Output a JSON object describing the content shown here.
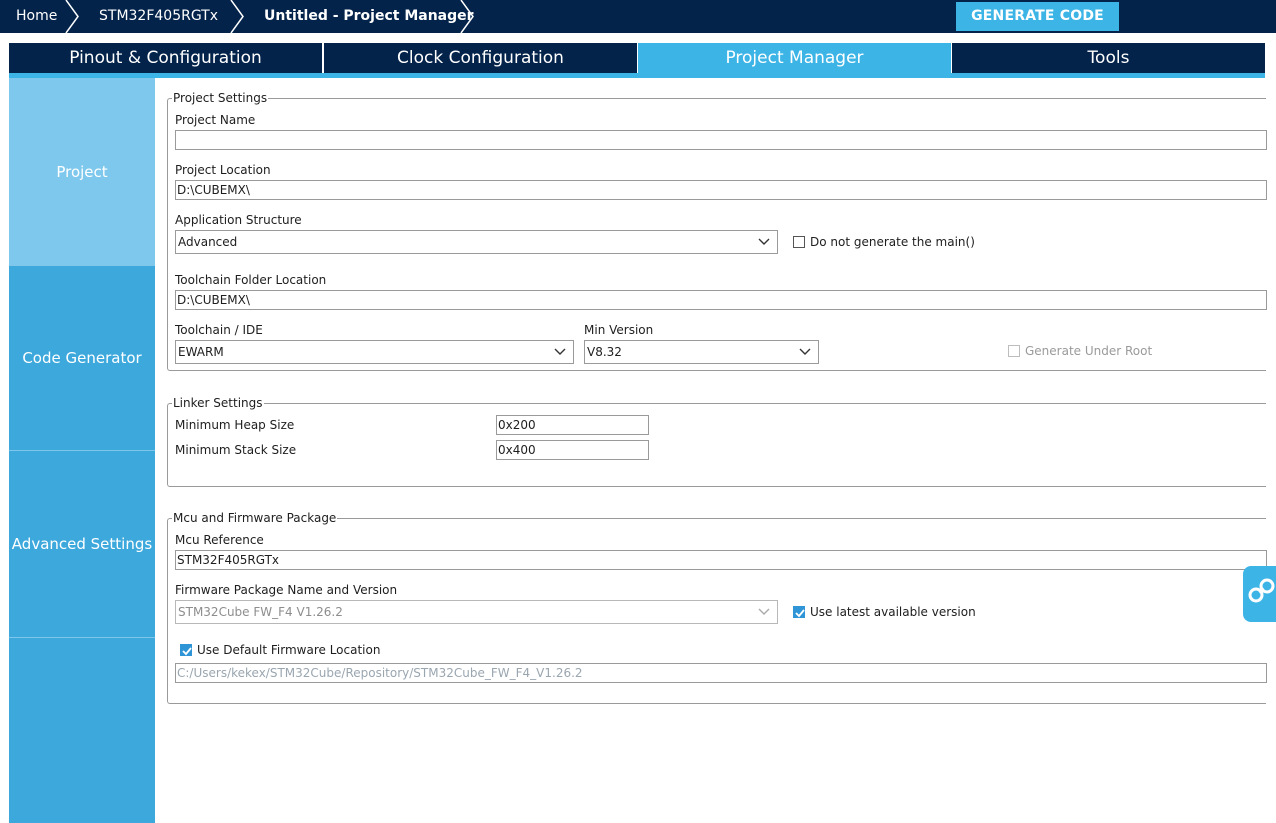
{
  "breadcrumb": {
    "home": "Home",
    "device": "STM32F405RGTx",
    "current": "Untitled - Project Manager"
  },
  "toolbar": {
    "generate_label": "GENERATE CODE"
  },
  "tabs": [
    {
      "label": "Pinout & Configuration"
    },
    {
      "label": "Clock Configuration"
    },
    {
      "label": "Project Manager"
    },
    {
      "label": "Tools"
    }
  ],
  "sidenav": {
    "items": [
      {
        "label": "Project"
      },
      {
        "label": "Code Generator"
      },
      {
        "label": "Advanced Settings"
      }
    ]
  },
  "project_settings": {
    "legend": "Project Settings",
    "project_name_label": "Project Name",
    "project_name_value": "",
    "project_location_label": "Project Location",
    "project_location_value": "D:\\CUBEMX\\",
    "app_structure_label": "Application Structure",
    "app_structure_value": "Advanced",
    "no_main_label": "Do not generate the main()",
    "toolchain_folder_label": "Toolchain Folder Location",
    "toolchain_folder_value": "D:\\CUBEMX\\",
    "toolchain_label": "Toolchain / IDE",
    "toolchain_value": "EWARM",
    "min_version_label": "Min Version",
    "min_version_value": "V8.32",
    "generate_root_label": "Generate Under Root"
  },
  "linker_settings": {
    "legend": "Linker Settings",
    "heap_label": "Minimum Heap Size",
    "heap_value": "0x200",
    "stack_label": "Minimum Stack Size",
    "stack_value": "0x400"
  },
  "mcu_firmware": {
    "legend": "Mcu and Firmware Package",
    "mcu_ref_label": "Mcu Reference",
    "mcu_ref_value": "STM32F405RGTx",
    "fw_label": "Firmware Package Name and Version",
    "fw_value": "STM32Cube FW_F4 V1.26.2",
    "latest_label": "Use latest available version",
    "default_loc_label": "Use Default Firmware Location",
    "fw_path_value": "C:/Users/kekex/STM32Cube/Repository/STM32Cube_FW_F4_V1.26.2"
  },
  "colors": {
    "navy": "#03234b",
    "accent": "#3cb4e6",
    "sidenav": "#3ca8dc",
    "sidenav_active": "#7ec8ed"
  },
  "icons": {
    "breadcrumb_separator": "chevron-right-icon",
    "dropdown": "chevron-down-icon",
    "checkbox_checked": "checkmark-icon",
    "floating_button": "link-icon"
  }
}
